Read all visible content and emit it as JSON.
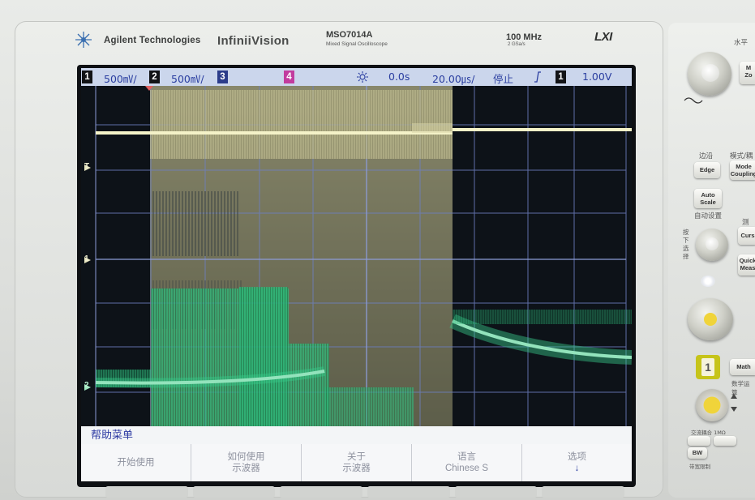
{
  "brand": {
    "company": "Agilent Technologies",
    "series": "InfiniiVision",
    "model": "MSO7014A",
    "model_subtitle": "Mixed Signal Oscilloscope",
    "bandwidth": "100 MHz",
    "sample_rate": "2 GSa/s",
    "lxi": "LXI"
  },
  "status_bar": {
    "ch1_number": "1",
    "ch1_scale": "500㎷/",
    "ch2_number": "2",
    "ch2_scale": "500㎷/",
    "ch3_number": "3",
    "ch4_number": "4",
    "trigger_position_icon": "sun-icon",
    "time_delay": "0.0s",
    "time_scale": "20.00㎲/",
    "run_state": "停止",
    "trigger_edge_icon": "rising-edge-icon",
    "trigger_source": "1",
    "trigger_level": "1.00V"
  },
  "markers": {
    "trigger_marker": "T",
    "ch1_marker": "1",
    "ch2_marker": "2"
  },
  "colors": {
    "ch1_trace": "#f2f0c4",
    "ch2_trace": "#37c989",
    "grid": "#6d7fc0",
    "status_bg": "#cbd6ec",
    "status_text": "#2a3ea0"
  },
  "help_menu": {
    "title": "帮助菜单",
    "softkeys": [
      {
        "line1": "开始使用",
        "line2": ""
      },
      {
        "line1": "如何使用",
        "line2": "示波器"
      },
      {
        "line1": "关于",
        "line2": "示波器"
      },
      {
        "line1": "语言",
        "line2": "Chinese S"
      },
      {
        "line1": "选项",
        "line2": "↓"
      }
    ]
  },
  "panel": {
    "horizontal_label": "水平",
    "edge_group_label": "边沿",
    "mode_group_label": "模式/耦",
    "edge_button": "Edge",
    "mode_button": "Mode Coupling",
    "auto_scale_button": "Auto Scale",
    "auto_scale_caption": "自动设置",
    "measure_label": "测量",
    "cursors_button": "Curs",
    "quick_meas_button": "Quick Meas",
    "math_button": "Math",
    "math_caption": "数学运算",
    "ch1_button": "1",
    "bw_label": "BW",
    "coupling_label": "交流耦合 1MΩ",
    "invert_label": "带宽限制",
    "select_caption": "按下选择"
  }
}
